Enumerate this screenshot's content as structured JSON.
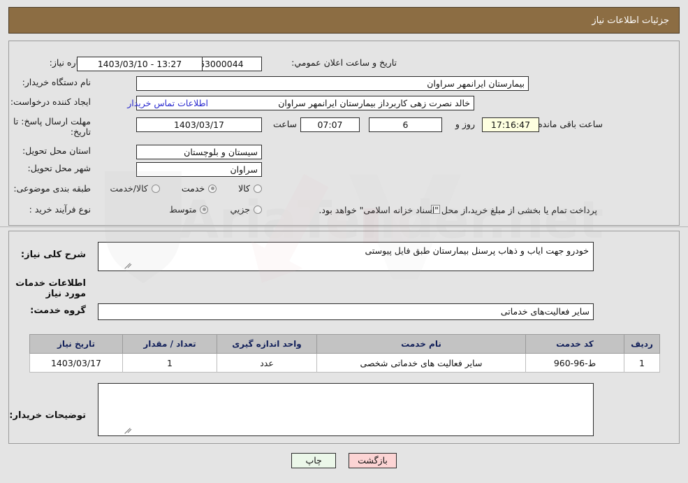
{
  "header": {
    "title": "جزئیات اطلاعات نیاز"
  },
  "form": {
    "need_number_label": "شماره نیاز:",
    "need_number_value": "1103093963000044",
    "announce_datetime_label": "تاریخ و ساعت اعلان عمومي:",
    "announce_datetime_value": "13:27 - 1403/03/10",
    "buyer_org_label": "نام دستگاه خریدار:",
    "buyer_org_value": "بیمارستان ایرانمهر سراوان",
    "requester_label": "ایجاد کننده درخواست:",
    "requester_value": "خالد نصرت زهی کاربرداز بیمارستان ایرانمهر سراوان",
    "contact_link": "اطلاعات تماس خریدار",
    "deadline_label": "مهلت ارسال پاسخ: تا تاریخ:",
    "deadline_date": "1403/03/17",
    "hour_label": "ساعت",
    "deadline_time": "07:07",
    "days_value": "6",
    "days_and_label": "روز و",
    "countdown_value": "17:16:47",
    "remaining_label": "ساعت باقی مانده",
    "province_label": "استان محل تحویل:",
    "province_value": "سیستان و بلوچستان",
    "city_label": "شهر محل تحویل:",
    "city_value": "سراوان",
    "category_label": "طبقه بندی موضوعی:",
    "category_options": [
      {
        "label": "کالا",
        "selected": false
      },
      {
        "label": "خدمت",
        "selected": true
      },
      {
        "label": "کالا/خدمت",
        "selected": false
      }
    ],
    "process_label": "نوع فرآیند خرید :",
    "process_options": [
      {
        "label": "جزیي",
        "selected": false
      },
      {
        "label": "متوسط",
        "selected": true
      }
    ],
    "treasury_checkbox_checked": false,
    "treasury_text": "پرداخت تمام یا بخشی از مبلغ خرید،از محل \"اسناد خزانه اسلامی\" خواهد بود."
  },
  "detail": {
    "general_desc_label": "شرح کلی نیاز:",
    "general_desc_value": "خودرو جهت ایاب و ذهاب پرسنل بیمارستان طبق فایل پیوستی",
    "services_heading": "اطلاعات خدمات مورد نیاز",
    "service_group_label": "گروه خدمت:",
    "service_group_value": "سایر فعالیت‌های خدماتی",
    "buyer_notes_label": "توضیحات خریدار:",
    "buyer_notes_value": ""
  },
  "table": {
    "columns": [
      "ردیف",
      "کد خدمت",
      "نام خدمت",
      "واحد اندازه گیری",
      "تعداد / مقدار",
      "تاریخ نیاز"
    ],
    "rows": [
      {
        "row_no": "1",
        "service_code": "ط-96-960",
        "service_name": "سایر فعالیت های خدماتی شخصی",
        "unit": "عدد",
        "quantity": "1",
        "need_date": "1403/03/17"
      }
    ]
  },
  "buttons": {
    "print": "چاپ",
    "back": "بازگشت"
  },
  "watermark": {
    "text": "AriaTender.net"
  },
  "colors": {
    "header_bar": "#8c6d43",
    "page_bg": "#e4e4e4",
    "link": "#2b2bcf",
    "table_header": "#c3c3c3",
    "table_header_text": "#12205a",
    "countdown_bg": "#feffe0",
    "btn_print_bg": "#ebf7e9",
    "btn_back_bg": "#fcd4d4"
  }
}
